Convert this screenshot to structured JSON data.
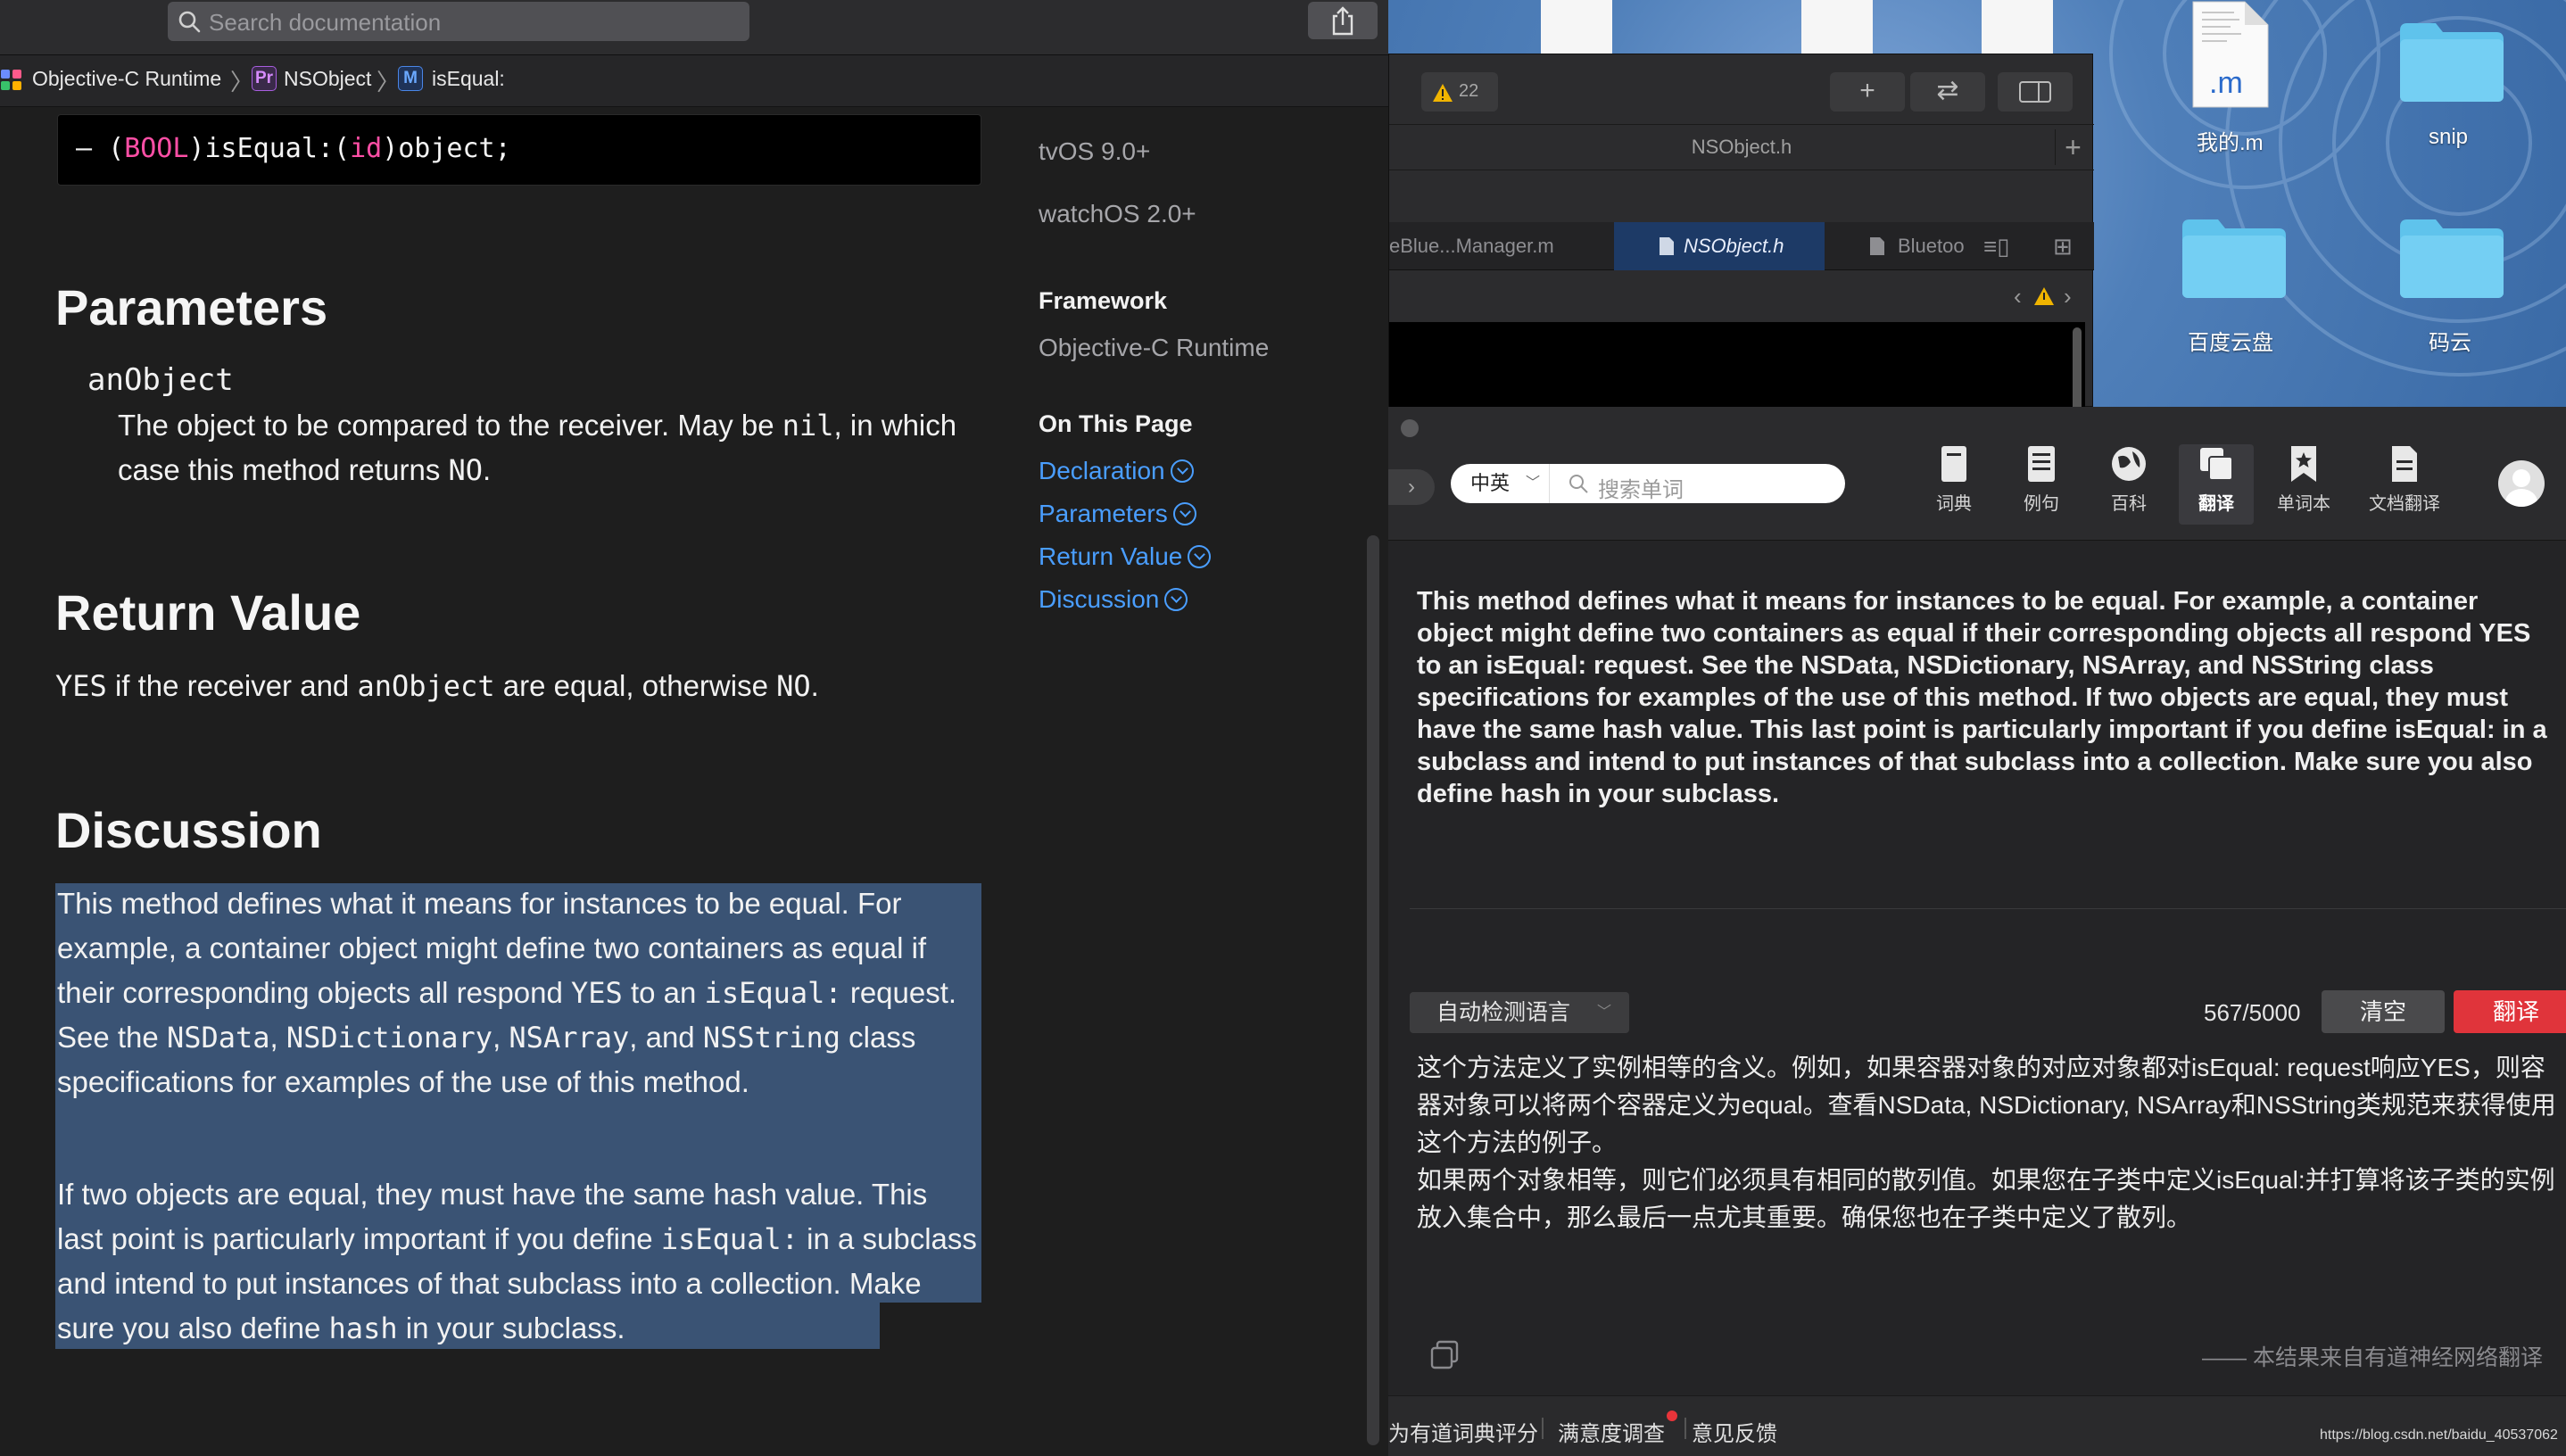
{
  "doc": {
    "search_placeholder": "Search documentation",
    "breadcrumb": [
      "Objective-C Runtime",
      "NSObject",
      "isEqual:"
    ],
    "breadcrumb_badges": [
      "Pr",
      "M"
    ],
    "declaration": {
      "dash": "–",
      "open1": "(",
      "type": "BOOL",
      "close1": ")isEqual:(",
      "argtype": "id",
      "tail": ")object;"
    },
    "parameters": {
      "heading": "Parameters",
      "name": "anObject",
      "desc_a": "The object to be compared to the receiver. May be ",
      "desc_code": "nil",
      "desc_b": ", in which case this method returns ",
      "desc_no": "NO",
      "desc_end": "."
    },
    "return_value": {
      "heading": "Return Value",
      "yes": "YES",
      "a": " if the receiver and ",
      "code": "anObject",
      "b": " are equal, otherwise ",
      "no": "NO",
      "end": "."
    },
    "discussion": {
      "heading": "Discussion",
      "p1_a": "This method defines what it means for instances to be equal. For example, a container object might define two containers as equal if their corresponding objects all respond ",
      "p1_yes": "YES",
      "p1_b": " to an ",
      "p1_code1": "isEqual:",
      "p1_c": " request. See the ",
      "p1_code2": "NSData",
      "p1_sep1": ", ",
      "p1_code3": "NSDictionary",
      "p1_sep2": ", ",
      "p1_code4": "NSArray",
      "p1_d": ", and ",
      "p1_code5": "NSString",
      "p1_e": " class specifications for examples of the use of this method.",
      "p2_a": "If two objects are equal, they must have the same hash value. This last point is particularly important if you define ",
      "p2_code1": "isEqual:",
      "p2_b": " in a subclass and intend to put instances of that subclass into a collection. Make sure you also define ",
      "p2_code2": "hash",
      "p2_c": " in your subclass."
    },
    "sidebar": {
      "platforms": [
        "tvOS 9.0+",
        "watchOS 2.0+"
      ],
      "framework_label": "Framework",
      "framework_value": "Objective-C Runtime",
      "on_this_page_label": "On This Page",
      "links": [
        "Declaration",
        "Parameters",
        "Return Value",
        "Discussion"
      ]
    }
  },
  "xcode": {
    "warning_count": "22",
    "file_title": "NSObject.h",
    "tabs": [
      "eBlue...Manager.m",
      "NSObject.h",
      "Bluetoo"
    ]
  },
  "desktop": {
    "items": [
      "我的.m",
      "snip",
      "百度云盘",
      "码云"
    ],
    "file_ext": ".m"
  },
  "youdao": {
    "lang_select": "中英",
    "search_placeholder": "搜索单词",
    "toolbar": [
      "词典",
      "例句",
      "百科",
      "翻译",
      "单词本",
      "文档翻译"
    ],
    "source_text": "This method defines what it means for instances to be equal. For example, a container object might define two containers as equal if their corresponding objects all respond YES to an isEqual: request. See the NSData, NSDictionary, NSArray, and NSString class specifications for examples of the use of this method. If two objects are equal, they must have the same hash value. This last point is particularly important if you define isEqual: in a subclass and intend to put instances of that subclass into a collection. Make sure you also define hash in your subclass.",
    "auto_detect": "自动检测语言",
    "char_count": "567/5000",
    "clear_label": "清空",
    "translate_label": "翻译",
    "translation_p1": "这个方法定义了实例相等的含义。例如，如果容器对象的对应对象都对isEqual: request响应YES，则容器对象可以将两个容器定义为equal。查看NSData, NSDictionary, NSArray和NSString类规范来获得使用这个方法的例子。",
    "translation_p2": "如果两个对象相等，则它们必须具有相同的散列值。如果您在子类中定义isEqual:并打算将该子类的实例放入集合中，那么最后一点尤其重要。确保您也在子类中定义了散列。",
    "attribution": "—— 本结果来自有道神经网络翻译",
    "footer": [
      "为有道词典评分",
      "满意度调查",
      "意见反馈"
    ]
  },
  "watermark": "https://blog.csdn.net/baidu_40537062"
}
